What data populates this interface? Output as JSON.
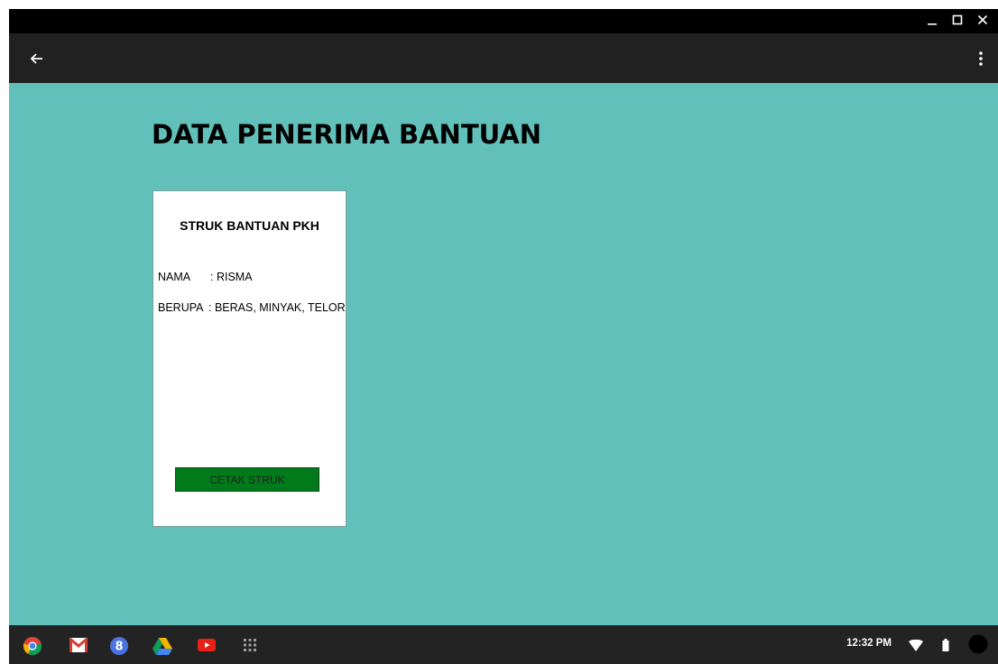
{
  "window": {
    "controls": [
      "minimize-icon",
      "maximize-icon",
      "close-icon"
    ]
  },
  "appbar": {
    "back_icon": "arrow-left-icon",
    "menu_icon": "more-vertical-icon"
  },
  "page": {
    "title": "DATA PENERIMA BANTUAN",
    "background": "#62c0bb"
  },
  "receipt": {
    "title": "STRUK BANTUAN PKH",
    "rows": [
      {
        "label": "NAMA",
        "value": ": RISMA"
      },
      {
        "label": "BERUPA",
        "value": ": BERAS, MINYAK, TELOR"
      }
    ],
    "print_button_label": "CETAK STRUK",
    "print_button_color": "#007a1a"
  },
  "shelf": {
    "apps": [
      "chrome-icon",
      "gmail-icon",
      "google-plus-icon",
      "drive-icon",
      "youtube-icon",
      "app-launcher-icon"
    ],
    "clock": "12:32 PM",
    "tray_icons": [
      "wifi-icon",
      "battery-icon",
      "account-avatar"
    ]
  }
}
